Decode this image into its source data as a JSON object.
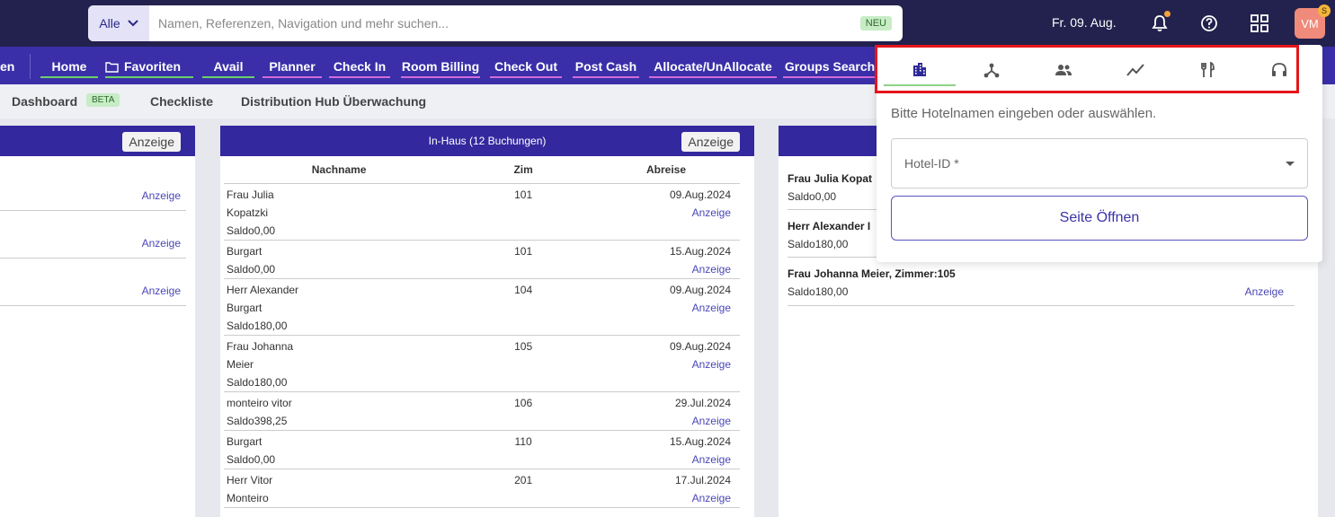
{
  "search": {
    "scope": "Alle",
    "placeholder": "Namen, Referenzen, Navigation und mehr suchen...",
    "badge": "NEU"
  },
  "top": {
    "date": "Fr. 09. Aug.",
    "avatar": "VM",
    "avatar_badge": "S"
  },
  "nav": {
    "cut_item": "en",
    "items": [
      "Home",
      "Favoriten",
      "Avail",
      "Planner",
      "Check In",
      "Room Billing",
      "Check Out",
      "Post Cash",
      "Allocate/UnAllocate",
      "Groups Search"
    ]
  },
  "subnav": {
    "dashboard": "Dashboard",
    "beta": "BETA",
    "checklist": "Checkliste",
    "hub": "Distribution Hub Überwachung"
  },
  "left_panel": {
    "button": "Anzeige",
    "link": "Anzeige"
  },
  "inhaus": {
    "title": "In-Haus (12 Buchungen)",
    "button": "Anzeige",
    "link": "Anzeige",
    "headers": [
      "Nachname",
      "Zim",
      "Abreise"
    ],
    "rows": [
      {
        "lines": [
          "Frau Julia",
          "Kopatzki",
          "Saldo0,00"
        ],
        "zim": "101",
        "abreise": "09.Aug.2024"
      },
      {
        "lines": [
          "Burgart",
          "Saldo0,00"
        ],
        "zim": "101",
        "abreise": "15.Aug.2024"
      },
      {
        "lines": [
          "Herr Alexander",
          "Burgart",
          "Saldo180,00"
        ],
        "zim": "104",
        "abreise": "09.Aug.2024"
      },
      {
        "lines": [
          "Frau Johanna",
          "Meier",
          "Saldo180,00"
        ],
        "zim": "105",
        "abreise": "09.Aug.2024"
      },
      {
        "lines": [
          "monteiro vitor",
          "Saldo398,25"
        ],
        "zim": "106",
        "abreise": "29.Jul.2024"
      },
      {
        "lines": [
          "Burgart",
          "Saldo0,00"
        ],
        "zim": "110",
        "abreise": "15.Aug.2024"
      },
      {
        "lines": [
          "Herr Vitor",
          "Monteiro"
        ],
        "zim": "201",
        "abreise": "17.Jul.2024"
      }
    ]
  },
  "right_panel": {
    "link": "Anzeige",
    "rows": [
      {
        "name": "Frau Julia Kopat",
        "saldo": "Saldo0,00"
      },
      {
        "name": "Herr Alexander I",
        "saldo": "Saldo180,00"
      },
      {
        "name": "Frau Johanna Meier, Zimmer:105",
        "saldo": "Saldo180,00"
      }
    ]
  },
  "popup": {
    "tabs": [
      "hotel-icon",
      "hub-icon",
      "group-icon",
      "chart-icon",
      "restaurant-icon",
      "support-icon"
    ],
    "active_tab": 0,
    "hint": "Bitte Hotelnamen eingeben oder auswählen.",
    "select_label": "Hotel-ID *",
    "open_button": "Seite Öffnen"
  },
  "colors": {
    "topbar": "#23224e",
    "navbar": "#3a2fa8",
    "panel_header": "#33289e",
    "highlight": "#e5161b"
  }
}
